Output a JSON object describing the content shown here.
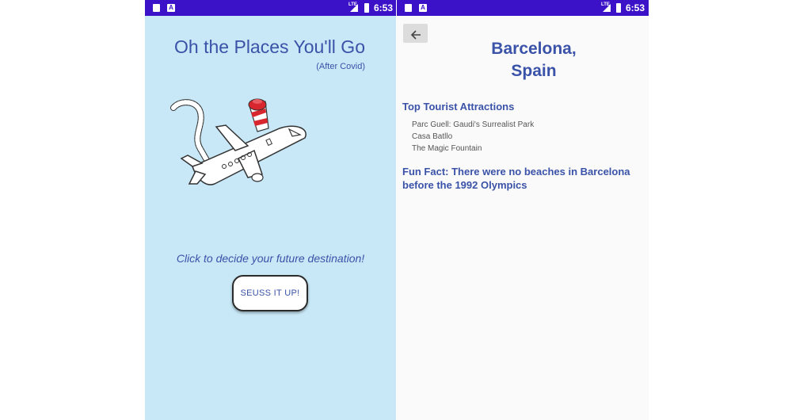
{
  "status_bar": {
    "time": "6:53",
    "network": "LTE"
  },
  "home": {
    "title": "Oh the Places You'll Go",
    "subtitle": "(After Covid)",
    "prompt": "Click to decide your future destination!",
    "button_label": "SEUSS IT UP!"
  },
  "destination": {
    "back_icon": "arrow-left-icon",
    "city": "Barcelona,",
    "country": "Spain",
    "attractions_heading": "Top Tourist Attractions",
    "attractions": [
      "Parc Guell: Gaudi's Surrealist Park",
      "Casa Batllo",
      "The Magic Fountain"
    ],
    "fun_fact": "Fun Fact: There were no beaches in Barcelona before the 1992 Olympics"
  },
  "colors": {
    "status_bar": "#3b12c7",
    "home_background": "#c8e8f7",
    "accent_text": "#3a52a8",
    "hat_red": "#d8262e"
  }
}
